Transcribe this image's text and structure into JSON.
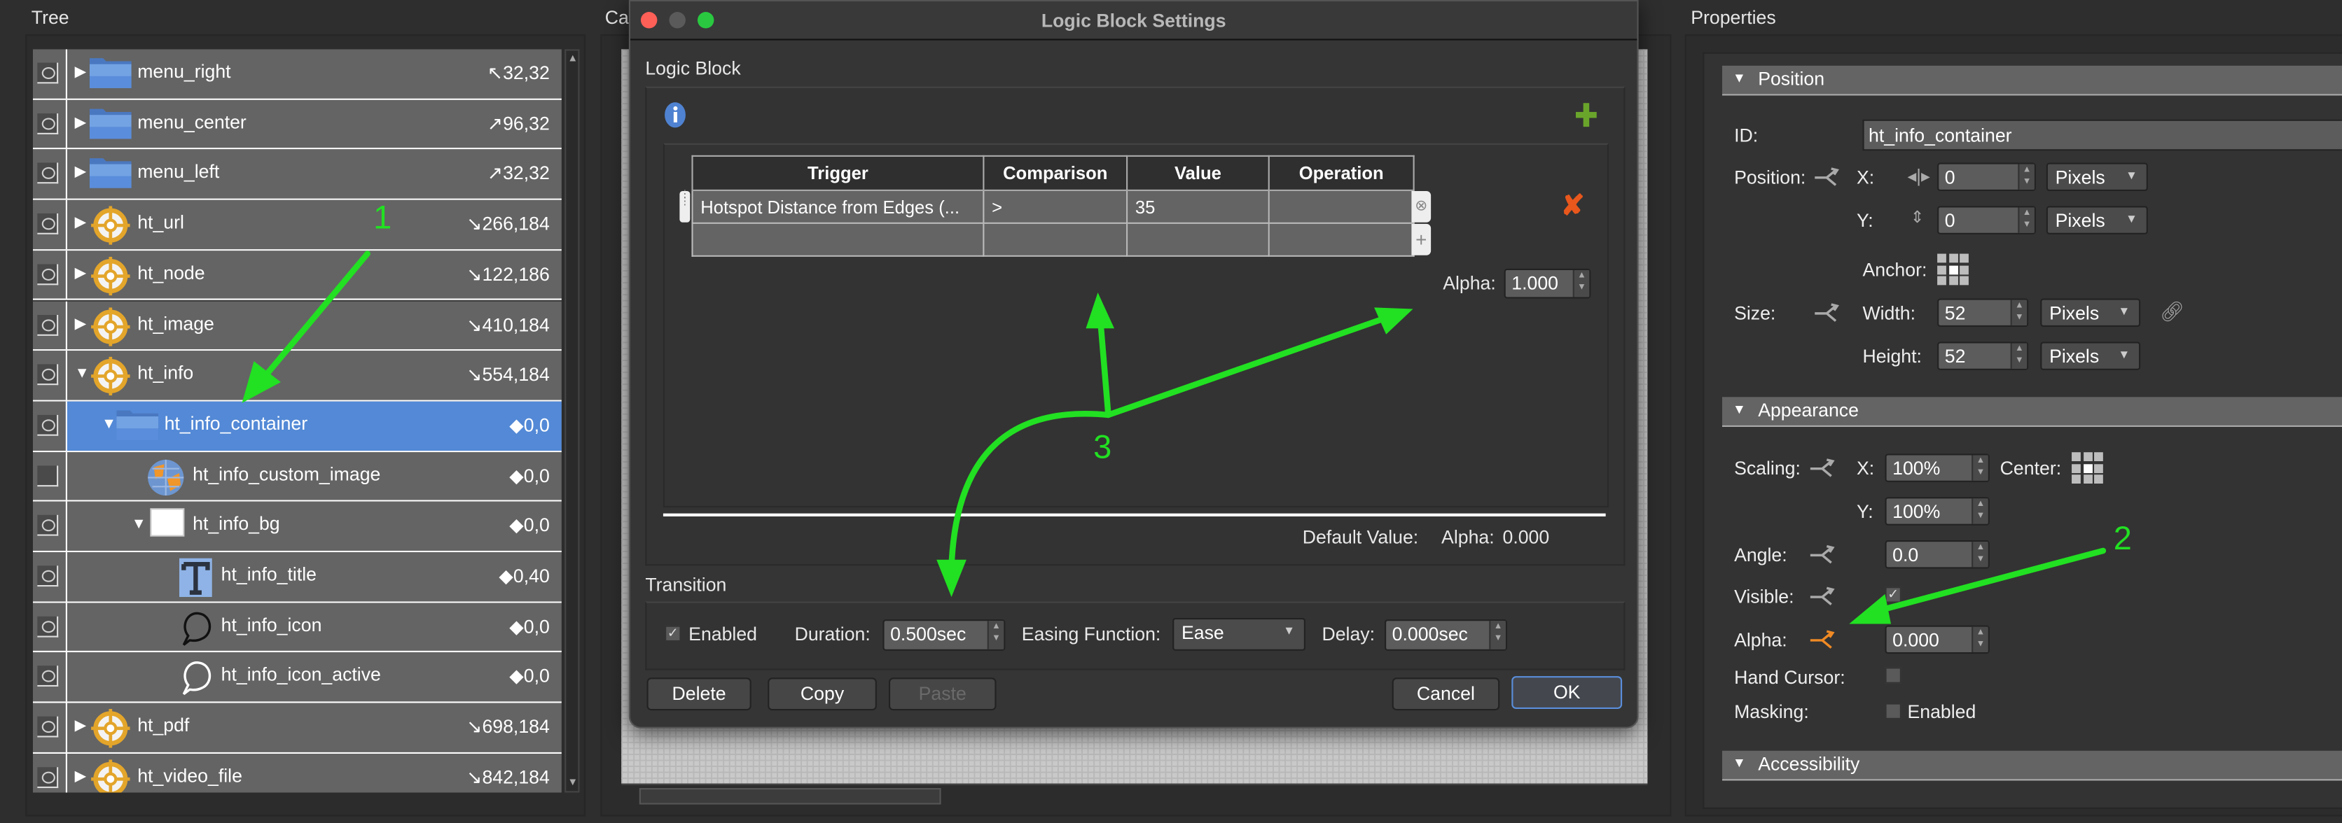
{
  "tree": {
    "title": "Tree",
    "rows": [
      {
        "name": "menu_right",
        "coord": "↖32,32",
        "icon": "folder",
        "level": 0,
        "expander": "collapsed",
        "visible": true
      },
      {
        "name": "menu_center",
        "coord": "↗96,32",
        "icon": "folder",
        "level": 0,
        "expander": "collapsed",
        "visible": true
      },
      {
        "name": "menu_left",
        "coord": "↗32,32",
        "icon": "folder",
        "level": 0,
        "expander": "collapsed",
        "visible": true
      },
      {
        "name": "ht_url",
        "coord": "↘266,184",
        "icon": "hotspot",
        "level": 0,
        "expander": "collapsed",
        "visible": true
      },
      {
        "name": "ht_node",
        "coord": "↘122,186",
        "icon": "hotspot",
        "level": 0,
        "expander": "collapsed",
        "visible": true
      },
      {
        "name": "ht_image",
        "coord": "↘410,184",
        "icon": "hotspot",
        "level": 0,
        "expander": "collapsed",
        "visible": true
      },
      {
        "name": "ht_info",
        "coord": "↘554,184",
        "icon": "hotspot",
        "level": 0,
        "expander": "expanded",
        "visible": true
      },
      {
        "name": "ht_info_container",
        "coord": "◆0,0",
        "icon": "folder",
        "level": 1,
        "expander": "expanded",
        "visible": true,
        "selected": true
      },
      {
        "name": "ht_info_custom_image",
        "coord": "◆0,0",
        "icon": "globe",
        "level": 2,
        "expander": "none",
        "visible": false
      },
      {
        "name": "ht_info_bg",
        "coord": "◆0,0",
        "icon": "rectangle",
        "level": 2,
        "expander": "expanded",
        "visible": true
      },
      {
        "name": "ht_info_title",
        "coord": "◆0,40",
        "icon": "text",
        "level": 3,
        "expander": "none",
        "visible": true
      },
      {
        "name": "ht_info_icon",
        "coord": "◆0,0",
        "icon": "speech-bubble-dark",
        "level": 3,
        "expander": "none",
        "visible": true
      },
      {
        "name": "ht_info_icon_active",
        "coord": "◆0,0",
        "icon": "speech-bubble-light",
        "level": 3,
        "expander": "none",
        "visible": true
      },
      {
        "name": "ht_pdf",
        "coord": "↘698,184",
        "icon": "hotspot",
        "level": 0,
        "expander": "collapsed",
        "visible": true
      },
      {
        "name": "ht_video_file",
        "coord": "↘842,184",
        "icon": "hotspot",
        "level": 0,
        "expander": "collapsed",
        "visible": true
      }
    ]
  },
  "canvas": {
    "title": "Ca"
  },
  "dialog": {
    "title": "Logic Block Settings",
    "logic_block_label": "Logic Block",
    "table": {
      "headers": [
        "Trigger",
        "Comparison",
        "Value",
        "Operation"
      ],
      "rows": [
        [
          "Hotspot Distance from Edges (...",
          ">",
          "35",
          ""
        ],
        [
          "",
          "",
          "",
          ""
        ]
      ]
    },
    "alpha_label": "Alpha:",
    "alpha_value": "1.000",
    "default_value_label": "Default Value:",
    "default_alpha_label": "Alpha:",
    "default_alpha_value": "0.000",
    "transition": {
      "label": "Transition",
      "enabled_label": "Enabled",
      "enabled": true,
      "duration_label": "Duration:",
      "duration_value": "0.500sec",
      "easing_label": "Easing Function:",
      "easing_value": "Ease",
      "delay_label": "Delay:",
      "delay_value": "0.000sec"
    },
    "buttons": {
      "delete": "Delete",
      "copy": "Copy",
      "paste": "Paste",
      "cancel": "Cancel",
      "ok": "OK"
    }
  },
  "properties": {
    "title": "Properties",
    "position": {
      "header": "Position",
      "id_label": "ID:",
      "id_value": "ht_info_container",
      "position_label": "Position:",
      "x_label": "X:",
      "x_value": "0",
      "x_unit": "Pixels",
      "y_label": "Y:",
      "y_value": "0",
      "y_unit": "Pixels",
      "anchor_label": "Anchor:",
      "size_label": "Size:",
      "width_label": "Width:",
      "width_value": "52",
      "width_unit": "Pixels",
      "height_label": "Height:",
      "height_value": "52",
      "height_unit": "Pixels"
    },
    "appearance": {
      "header": "Appearance",
      "scaling_label": "Scaling:",
      "sx_label": "X:",
      "sx_value": "100%",
      "center_label": "Center:",
      "sy_label": "Y:",
      "sy_value": "100%",
      "angle_label": "Angle:",
      "angle_value": "0.0",
      "visible_label": "Visible:",
      "visible": true,
      "alpha_label": "Alpha:",
      "alpha_value": "0.000",
      "hand_cursor_label": "Hand Cursor:",
      "hand_cursor": false,
      "masking_label": "Masking:",
      "masking_enabled_label": "Enabled",
      "masking": false
    },
    "accessibility": {
      "header": "Accessibility"
    }
  },
  "annotations": {
    "one": "1",
    "two": "2",
    "three": "3",
    "color": "#22e022"
  },
  "colors": {
    "selection": "#5389d6",
    "animated_property": "#f08a24",
    "delete_x": "#e8571c",
    "add_plus": "#6aa52b"
  }
}
